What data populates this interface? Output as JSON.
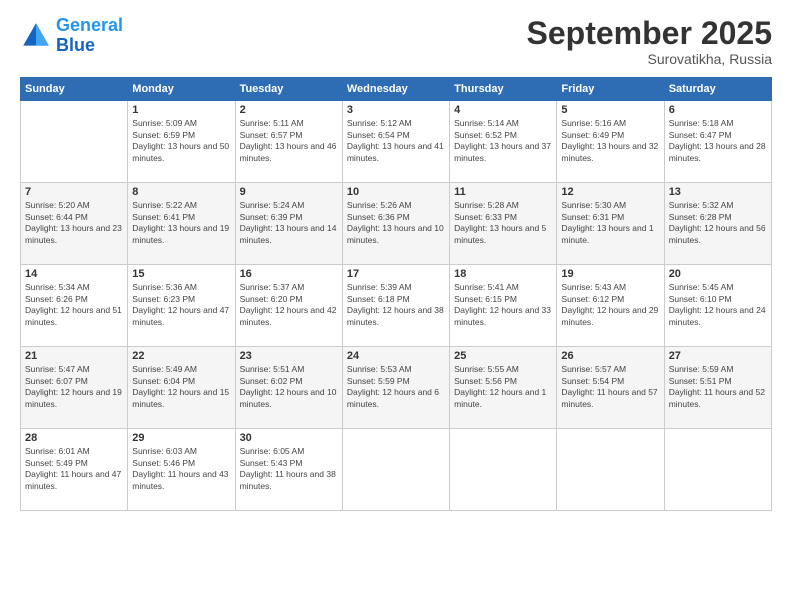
{
  "header": {
    "logo_line1": "General",
    "logo_line2": "Blue",
    "month": "September 2025",
    "location": "Surovatikha, Russia"
  },
  "days_of_week": [
    "Sunday",
    "Monday",
    "Tuesday",
    "Wednesday",
    "Thursday",
    "Friday",
    "Saturday"
  ],
  "weeks": [
    [
      {
        "num": "",
        "sunrise": "",
        "sunset": "",
        "daylight": ""
      },
      {
        "num": "1",
        "sunrise": "Sunrise: 5:09 AM",
        "sunset": "Sunset: 6:59 PM",
        "daylight": "Daylight: 13 hours and 50 minutes."
      },
      {
        "num": "2",
        "sunrise": "Sunrise: 5:11 AM",
        "sunset": "Sunset: 6:57 PM",
        "daylight": "Daylight: 13 hours and 46 minutes."
      },
      {
        "num": "3",
        "sunrise": "Sunrise: 5:12 AM",
        "sunset": "Sunset: 6:54 PM",
        "daylight": "Daylight: 13 hours and 41 minutes."
      },
      {
        "num": "4",
        "sunrise": "Sunrise: 5:14 AM",
        "sunset": "Sunset: 6:52 PM",
        "daylight": "Daylight: 13 hours and 37 minutes."
      },
      {
        "num": "5",
        "sunrise": "Sunrise: 5:16 AM",
        "sunset": "Sunset: 6:49 PM",
        "daylight": "Daylight: 13 hours and 32 minutes."
      },
      {
        "num": "6",
        "sunrise": "Sunrise: 5:18 AM",
        "sunset": "Sunset: 6:47 PM",
        "daylight": "Daylight: 13 hours and 28 minutes."
      }
    ],
    [
      {
        "num": "7",
        "sunrise": "Sunrise: 5:20 AM",
        "sunset": "Sunset: 6:44 PM",
        "daylight": "Daylight: 13 hours and 23 minutes."
      },
      {
        "num": "8",
        "sunrise": "Sunrise: 5:22 AM",
        "sunset": "Sunset: 6:41 PM",
        "daylight": "Daylight: 13 hours and 19 minutes."
      },
      {
        "num": "9",
        "sunrise": "Sunrise: 5:24 AM",
        "sunset": "Sunset: 6:39 PM",
        "daylight": "Daylight: 13 hours and 14 minutes."
      },
      {
        "num": "10",
        "sunrise": "Sunrise: 5:26 AM",
        "sunset": "Sunset: 6:36 PM",
        "daylight": "Daylight: 13 hours and 10 minutes."
      },
      {
        "num": "11",
        "sunrise": "Sunrise: 5:28 AM",
        "sunset": "Sunset: 6:33 PM",
        "daylight": "Daylight: 13 hours and 5 minutes."
      },
      {
        "num": "12",
        "sunrise": "Sunrise: 5:30 AM",
        "sunset": "Sunset: 6:31 PM",
        "daylight": "Daylight: 13 hours and 1 minute."
      },
      {
        "num": "13",
        "sunrise": "Sunrise: 5:32 AM",
        "sunset": "Sunset: 6:28 PM",
        "daylight": "Daylight: 12 hours and 56 minutes."
      }
    ],
    [
      {
        "num": "14",
        "sunrise": "Sunrise: 5:34 AM",
        "sunset": "Sunset: 6:26 PM",
        "daylight": "Daylight: 12 hours and 51 minutes."
      },
      {
        "num": "15",
        "sunrise": "Sunrise: 5:36 AM",
        "sunset": "Sunset: 6:23 PM",
        "daylight": "Daylight: 12 hours and 47 minutes."
      },
      {
        "num": "16",
        "sunrise": "Sunrise: 5:37 AM",
        "sunset": "Sunset: 6:20 PM",
        "daylight": "Daylight: 12 hours and 42 minutes."
      },
      {
        "num": "17",
        "sunrise": "Sunrise: 5:39 AM",
        "sunset": "Sunset: 6:18 PM",
        "daylight": "Daylight: 12 hours and 38 minutes."
      },
      {
        "num": "18",
        "sunrise": "Sunrise: 5:41 AM",
        "sunset": "Sunset: 6:15 PM",
        "daylight": "Daylight: 12 hours and 33 minutes."
      },
      {
        "num": "19",
        "sunrise": "Sunrise: 5:43 AM",
        "sunset": "Sunset: 6:12 PM",
        "daylight": "Daylight: 12 hours and 29 minutes."
      },
      {
        "num": "20",
        "sunrise": "Sunrise: 5:45 AM",
        "sunset": "Sunset: 6:10 PM",
        "daylight": "Daylight: 12 hours and 24 minutes."
      }
    ],
    [
      {
        "num": "21",
        "sunrise": "Sunrise: 5:47 AM",
        "sunset": "Sunset: 6:07 PM",
        "daylight": "Daylight: 12 hours and 19 minutes."
      },
      {
        "num": "22",
        "sunrise": "Sunrise: 5:49 AM",
        "sunset": "Sunset: 6:04 PM",
        "daylight": "Daylight: 12 hours and 15 minutes."
      },
      {
        "num": "23",
        "sunrise": "Sunrise: 5:51 AM",
        "sunset": "Sunset: 6:02 PM",
        "daylight": "Daylight: 12 hours and 10 minutes."
      },
      {
        "num": "24",
        "sunrise": "Sunrise: 5:53 AM",
        "sunset": "Sunset: 5:59 PM",
        "daylight": "Daylight: 12 hours and 6 minutes."
      },
      {
        "num": "25",
        "sunrise": "Sunrise: 5:55 AM",
        "sunset": "Sunset: 5:56 PM",
        "daylight": "Daylight: 12 hours and 1 minute."
      },
      {
        "num": "26",
        "sunrise": "Sunrise: 5:57 AM",
        "sunset": "Sunset: 5:54 PM",
        "daylight": "Daylight: 11 hours and 57 minutes."
      },
      {
        "num": "27",
        "sunrise": "Sunrise: 5:59 AM",
        "sunset": "Sunset: 5:51 PM",
        "daylight": "Daylight: 11 hours and 52 minutes."
      }
    ],
    [
      {
        "num": "28",
        "sunrise": "Sunrise: 6:01 AM",
        "sunset": "Sunset: 5:49 PM",
        "daylight": "Daylight: 11 hours and 47 minutes."
      },
      {
        "num": "29",
        "sunrise": "Sunrise: 6:03 AM",
        "sunset": "Sunset: 5:46 PM",
        "daylight": "Daylight: 11 hours and 43 minutes."
      },
      {
        "num": "30",
        "sunrise": "Sunrise: 6:05 AM",
        "sunset": "Sunset: 5:43 PM",
        "daylight": "Daylight: 11 hours and 38 minutes."
      },
      {
        "num": "",
        "sunrise": "",
        "sunset": "",
        "daylight": ""
      },
      {
        "num": "",
        "sunrise": "",
        "sunset": "",
        "daylight": ""
      },
      {
        "num": "",
        "sunrise": "",
        "sunset": "",
        "daylight": ""
      },
      {
        "num": "",
        "sunrise": "",
        "sunset": "",
        "daylight": ""
      }
    ]
  ]
}
